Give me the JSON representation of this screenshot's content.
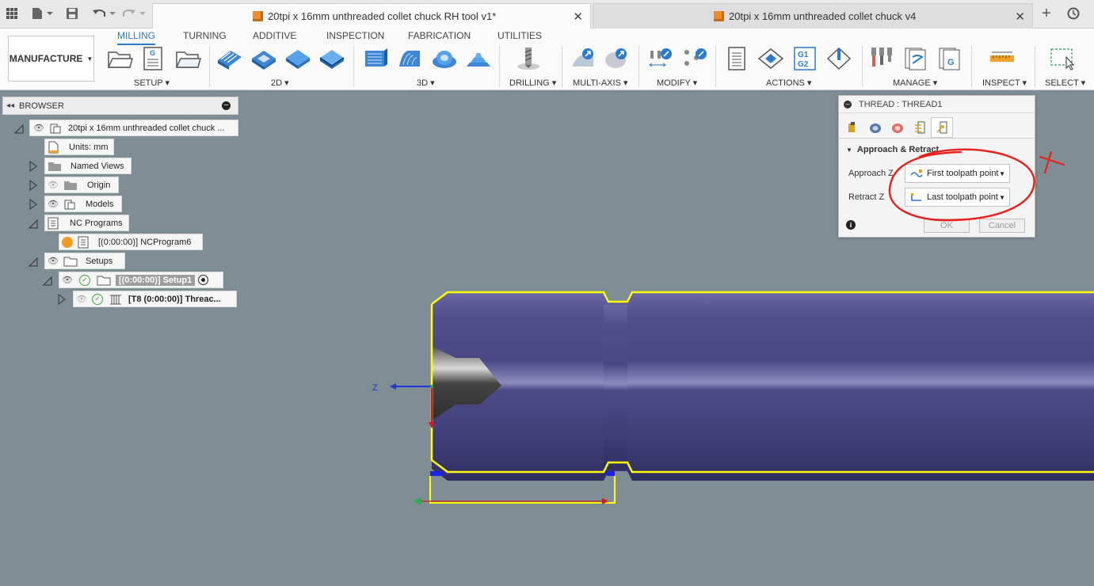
{
  "window": {
    "tabs": [
      {
        "label": "20tpi x 16mm unthreaded collet chuck RH tool v1*",
        "active": true
      },
      {
        "label": "20tpi x 16mm unthreaded collet chuck v4",
        "active": false
      }
    ],
    "icons": [
      "grid-icon",
      "file-icon",
      "save-icon",
      "undo-icon",
      "redo-icon",
      "new-tab-icon",
      "online-status-icon"
    ]
  },
  "ribbon": {
    "workspace": "MANUFACTURE",
    "tabs": [
      "MILLING",
      "TURNING",
      "ADDITIVE",
      "INSPECTION",
      "FABRICATION",
      "UTILITIES"
    ],
    "active_tab": "MILLING",
    "groups": [
      "SETUP",
      "2D",
      "3D",
      "DRILLING",
      "MULTI-AXIS",
      "MODIFY",
      "ACTIONS",
      "MANAGE",
      "INSPECT",
      "SELECT"
    ],
    "accent": "#2a7bd0"
  },
  "browser": {
    "title": "BROWSER",
    "nodes": {
      "root": "20tpi x 16mm unthreaded collet chuck ...",
      "units": "Units: mm",
      "named_views": "Named Views",
      "origin": "Origin",
      "models": "Models",
      "nc_programs": "NC Programs",
      "nc_program6": "[(0:00:00)] NCProgram6",
      "setups": "Setups",
      "setup1": "[(0:00:00)] Setup1",
      "thread_op": "[T8 (0:00:00)] Threac..."
    }
  },
  "dialog": {
    "title": "THREAD : THREAD1",
    "section": "Approach & Retract",
    "approach_label": "Approach Z",
    "approach_value": "First toolpath point",
    "retract_label": "Retract Z",
    "retract_value": "Last toolpath point",
    "ok": "OK",
    "cancel": "Cancel"
  },
  "viewport": {
    "axis_label": "Z",
    "background": "#7f8d95",
    "part_color": "#4f4d86",
    "highlight": "#ffff00",
    "annotation_color": "#e8201c"
  }
}
